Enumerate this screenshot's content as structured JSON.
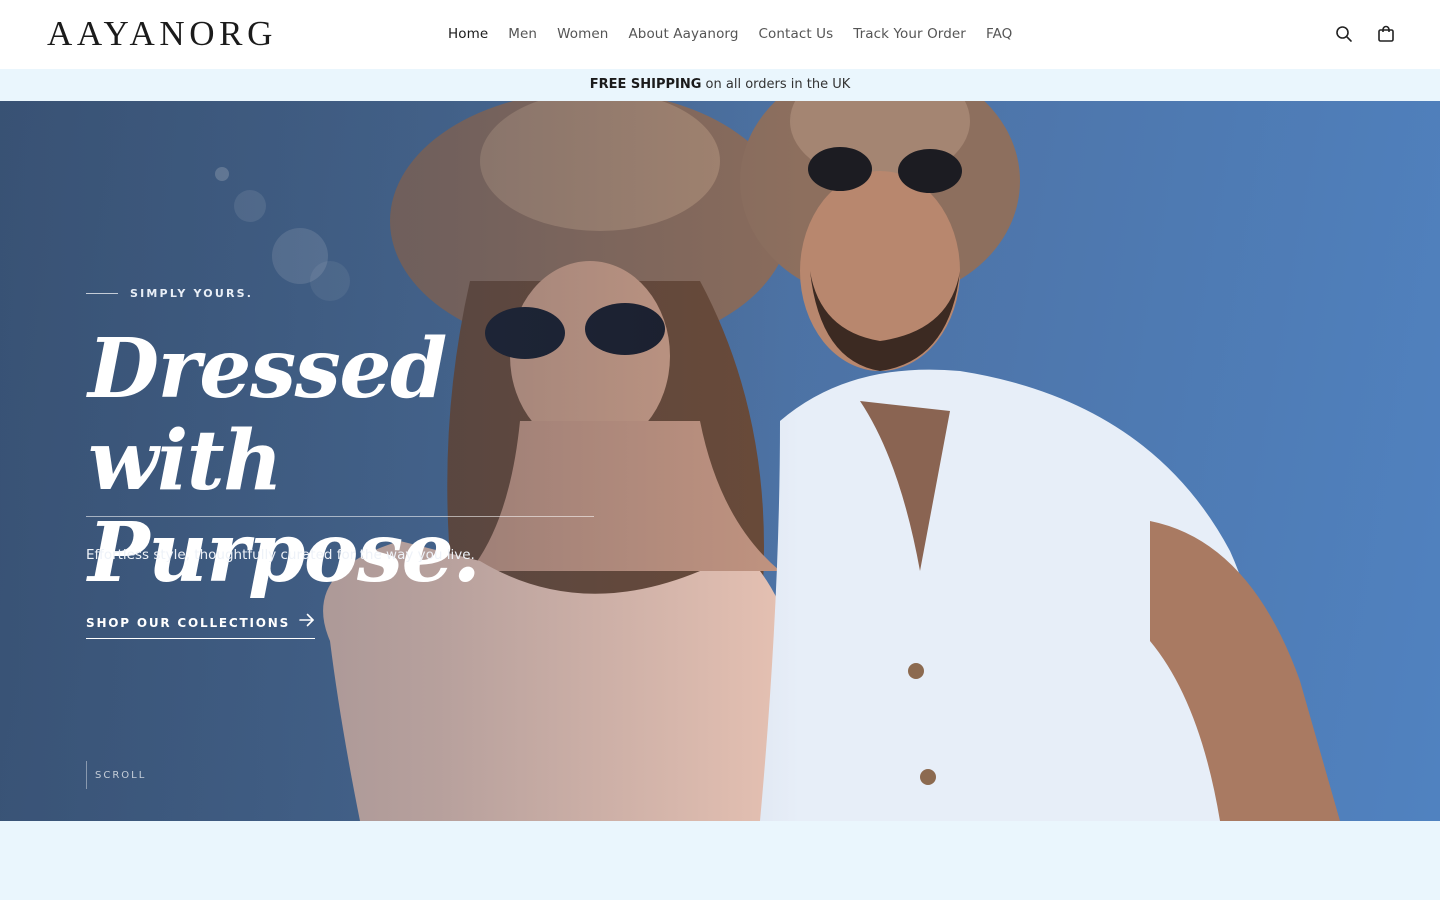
{
  "header": {
    "logo": "AAYANORG",
    "nav": [
      {
        "label": "Home"
      },
      {
        "label": "Men"
      },
      {
        "label": "Women"
      },
      {
        "label": "About Aayanorg"
      },
      {
        "label": "Contact Us"
      },
      {
        "label": "Track Your Order"
      },
      {
        "label": "FAQ"
      }
    ],
    "icons": {
      "search": "search-icon",
      "cart": "shopping-bag-icon"
    }
  },
  "promo": {
    "bold": "FREE SHIPPING",
    "rest": " on all orders in the UK"
  },
  "hero": {
    "eyebrow": "SIMPLY YOURS.",
    "headline_line1": "Dressed with",
    "headline_line2": "Purpose.",
    "subtext": "Effortless style, thoughtfully curated for the way you live.",
    "cta_label": "SHOP OUR COLLECTIONS",
    "cta_icon": "arrow-right-icon",
    "scroll_label": "SCROLL"
  },
  "colors": {
    "accent_bg": "#eaf6fd",
    "hero_sky": "#4d74a8",
    "text_dark": "#1b1b1b"
  }
}
